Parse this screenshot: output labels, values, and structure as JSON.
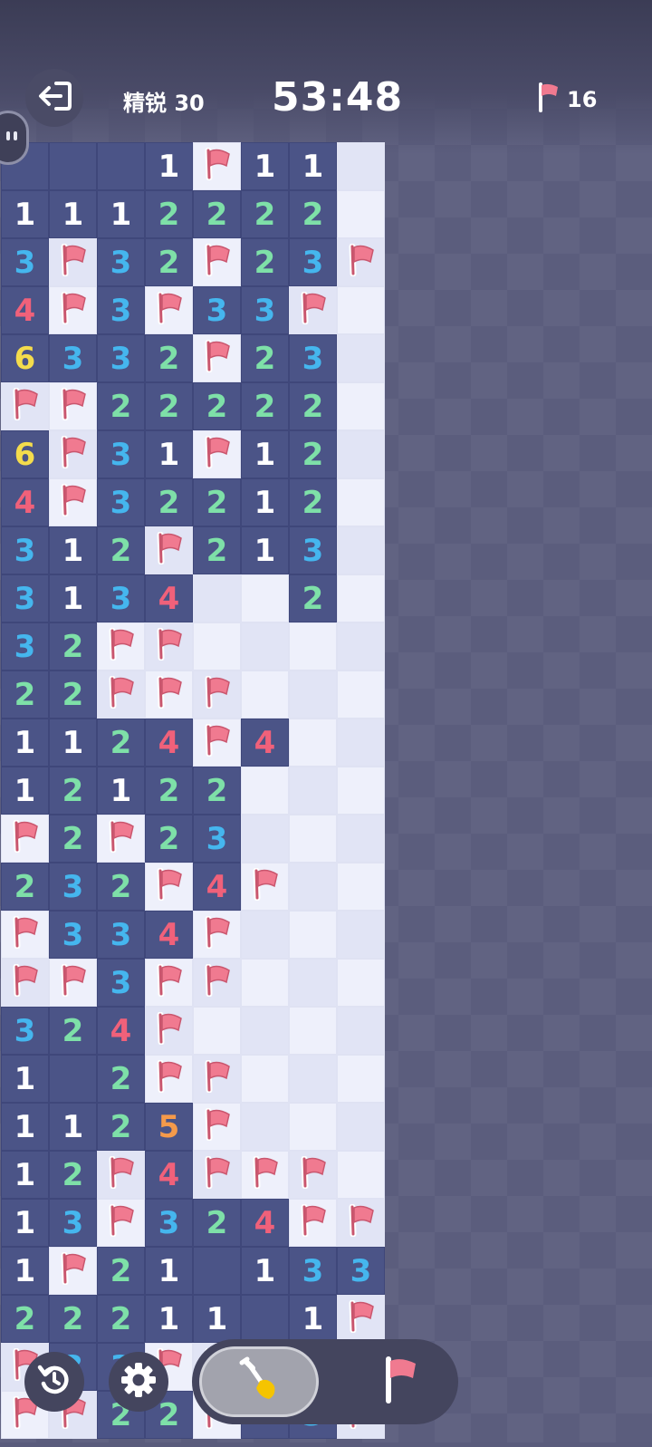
{
  "header": {
    "difficulty": "精锐 30",
    "timer": "53:48",
    "flag_count": "16"
  },
  "board": {
    "columns": 8,
    "rows": [
      [
        "R",
        "R",
        "R",
        "1",
        "F",
        "1",
        "1",
        "U"
      ],
      [
        "1",
        "1",
        "1",
        "2",
        "2",
        "2",
        "2",
        "U"
      ],
      [
        "3",
        "F",
        "3",
        "2",
        "F",
        "2",
        "3",
        "F"
      ],
      [
        "4",
        "F",
        "3",
        "F",
        "3",
        "3",
        "F",
        "U"
      ],
      [
        "6",
        "3",
        "3",
        "2",
        "F",
        "2",
        "3",
        "U"
      ],
      [
        "F",
        "F",
        "2",
        "2",
        "2",
        "2",
        "2",
        "U"
      ],
      [
        "6",
        "F",
        "3",
        "1",
        "F",
        "1",
        "2",
        "U"
      ],
      [
        "4",
        "F",
        "3",
        "2",
        "2",
        "1",
        "2",
        "U"
      ],
      [
        "3",
        "1",
        "2",
        "F",
        "2",
        "1",
        "3",
        "U"
      ],
      [
        "3",
        "1",
        "3",
        "4",
        "U",
        "U",
        "2",
        "U"
      ],
      [
        "3",
        "2",
        "F",
        "F",
        "U",
        "U",
        "U",
        "U"
      ],
      [
        "2",
        "2",
        "F",
        "F",
        "F",
        "U",
        "U",
        "U"
      ],
      [
        "1",
        "1",
        "2",
        "4",
        "F",
        "4",
        "U",
        "U"
      ],
      [
        "1",
        "2",
        "1",
        "2",
        "2",
        "U",
        "U",
        "U"
      ],
      [
        "F",
        "2",
        "F",
        "2",
        "3",
        "U",
        "U",
        "U"
      ],
      [
        "2",
        "3",
        "2",
        "F",
        "4",
        "F",
        "U",
        "U"
      ],
      [
        "F",
        "3",
        "3",
        "4",
        "F",
        "U",
        "U",
        "U"
      ],
      [
        "F",
        "F",
        "3",
        "F",
        "F",
        "U",
        "U",
        "U"
      ],
      [
        "3",
        "2",
        "4",
        "F",
        "U",
        "U",
        "U",
        "U"
      ],
      [
        "1",
        "R",
        "2",
        "F",
        "F",
        "U",
        "U",
        "U"
      ],
      [
        "1",
        "1",
        "2",
        "5",
        "F",
        "U",
        "U",
        "U"
      ],
      [
        "1",
        "2",
        "F",
        "4",
        "F",
        "F",
        "F",
        "U"
      ],
      [
        "1",
        "3",
        "F",
        "3",
        "2",
        "4",
        "F",
        "F"
      ],
      [
        "1",
        "F",
        "2",
        "1",
        "R",
        "1",
        "3",
        "3"
      ],
      [
        "2",
        "2",
        "2",
        "1",
        "1",
        "R",
        "1",
        "F"
      ],
      [
        "F",
        "3",
        "3",
        "F",
        "F",
        "R",
        "R",
        "F"
      ],
      [
        "F",
        "F",
        "2",
        "2",
        "F",
        "R",
        "3",
        "F"
      ]
    ]
  },
  "controls": {
    "exit": "exit-icon",
    "pause": "pause-icon",
    "undo": "undo-icon",
    "settings": "gear-icon",
    "dig": "shovel-icon",
    "flag": "flag-icon"
  },
  "colors": {
    "revealed": "#4b5487",
    "unrevealed": "#eef0fb",
    "flag": "#f07a90",
    "n1": "#ffffff",
    "n2": "#7ee0a8",
    "n3": "#45b6ee",
    "n4": "#f0617a",
    "n5": "#f59a4a",
    "n6": "#f4dc4c"
  }
}
